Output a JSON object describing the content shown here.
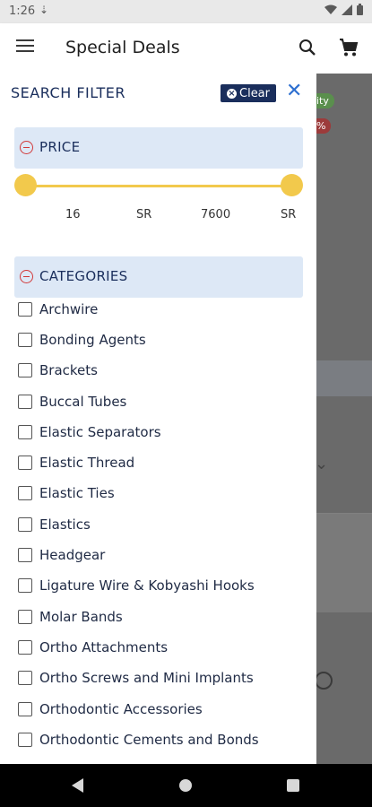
{
  "status_bar": {
    "time": "1:26",
    "download_glyph": "⇣"
  },
  "app_bar": {
    "title": "Special Deals",
    "icons": [
      "menu-icon",
      "search-icon",
      "cart-icon"
    ]
  },
  "background": {
    "pill_green": "ity",
    "pill_red": "%"
  },
  "filter": {
    "header": "SEARCH FILTER",
    "clear_label": "Clear",
    "close_glyph": "✕",
    "price": {
      "title": "PRICE",
      "min": "16",
      "max": "7600",
      "currency": "SR",
      "range_fraction": [
        0.0,
        1.0
      ]
    },
    "categories": {
      "title": "CATEGORIES",
      "items": [
        "Archwire",
        "Bonding Agents",
        "Brackets",
        "Buccal Tubes",
        "Elastic Separators",
        "Elastic Thread",
        "Elastic Ties",
        "Elastics",
        "Headgear",
        "Ligature Wire & Kobyashi Hooks",
        "Molar Bands",
        "Ortho Attachments",
        "Ortho Screws and Mini Implants",
        "Orthodontic Accessories",
        "Orthodontic Cements and Bonds"
      ]
    }
  },
  "colors": {
    "navy": "#1a2e5c",
    "slider": "#f2c94c",
    "section_bg": "#dde8f6",
    "close_blue": "#2d6fd0",
    "minus_red": "#d23a3a"
  }
}
